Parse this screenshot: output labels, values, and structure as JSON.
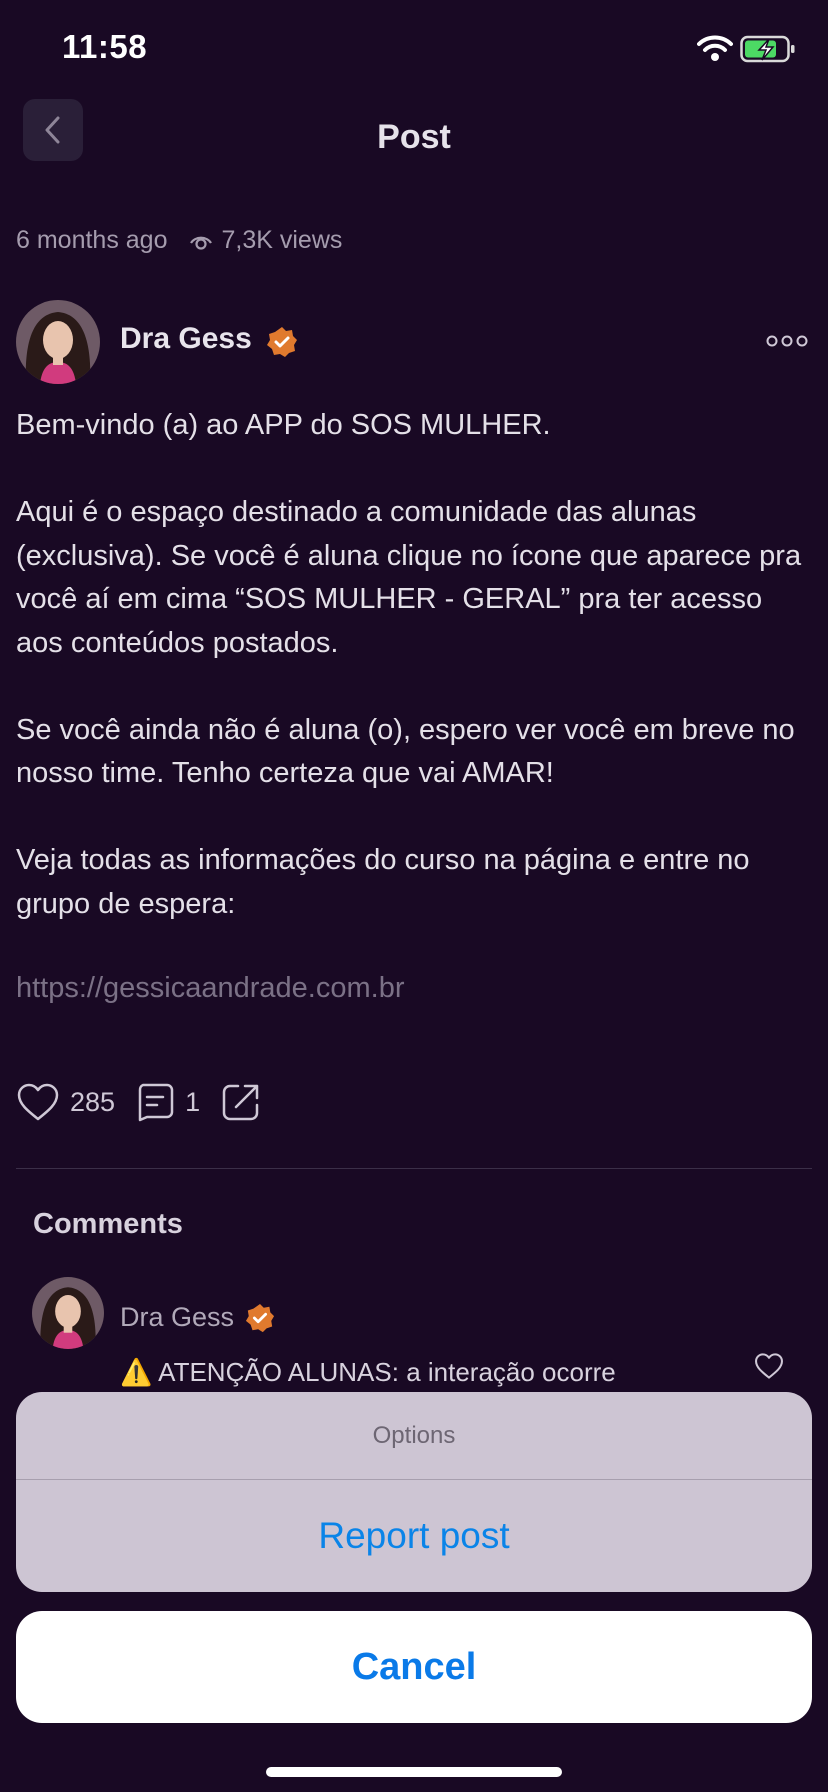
{
  "status_bar": {
    "time": "11:58"
  },
  "nav": {
    "title": "Post"
  },
  "post": {
    "time_ago": "6 months ago",
    "views": "7,3K views",
    "author": "Dra Gess",
    "paragraphs": [
      "Bem-vindo (a) ao APP do SOS MULHER.",
      "Aqui é o espaço destinado a comunidade das alunas (exclusiva). Se você é aluna clique no ícone que aparece pra você aí em cima “SOS MULHER - GERAL” pra ter acesso aos conteúdos postados.",
      "Se você ainda não é aluna (o), espero ver você em breve no nosso time. Tenho certeza que vai AMAR!",
      "Veja todas as informações do curso na página e entre no grupo de espera:"
    ],
    "link": "https://gessicaandrade.com.br",
    "likes": "285",
    "comments_count": "1"
  },
  "comments": {
    "title": "Comments",
    "items": [
      {
        "author": "Dra Gess",
        "text": "⚠️ ATENÇÃO ALUNAS: a interação ocorre"
      }
    ]
  },
  "action_sheet": {
    "title": "Options",
    "report_label": "Report post",
    "cancel_label": "Cancel"
  },
  "colors": {
    "background": "#190924",
    "verified_badge": "#e07a2e",
    "action_blue": "#0a84e8",
    "battery_green": "#4cd964"
  },
  "icons": [
    "back-icon",
    "wifi-icon",
    "battery-icon",
    "eye-icon",
    "verified-icon",
    "more-icon",
    "heart-icon",
    "comment-icon",
    "share-icon"
  ]
}
